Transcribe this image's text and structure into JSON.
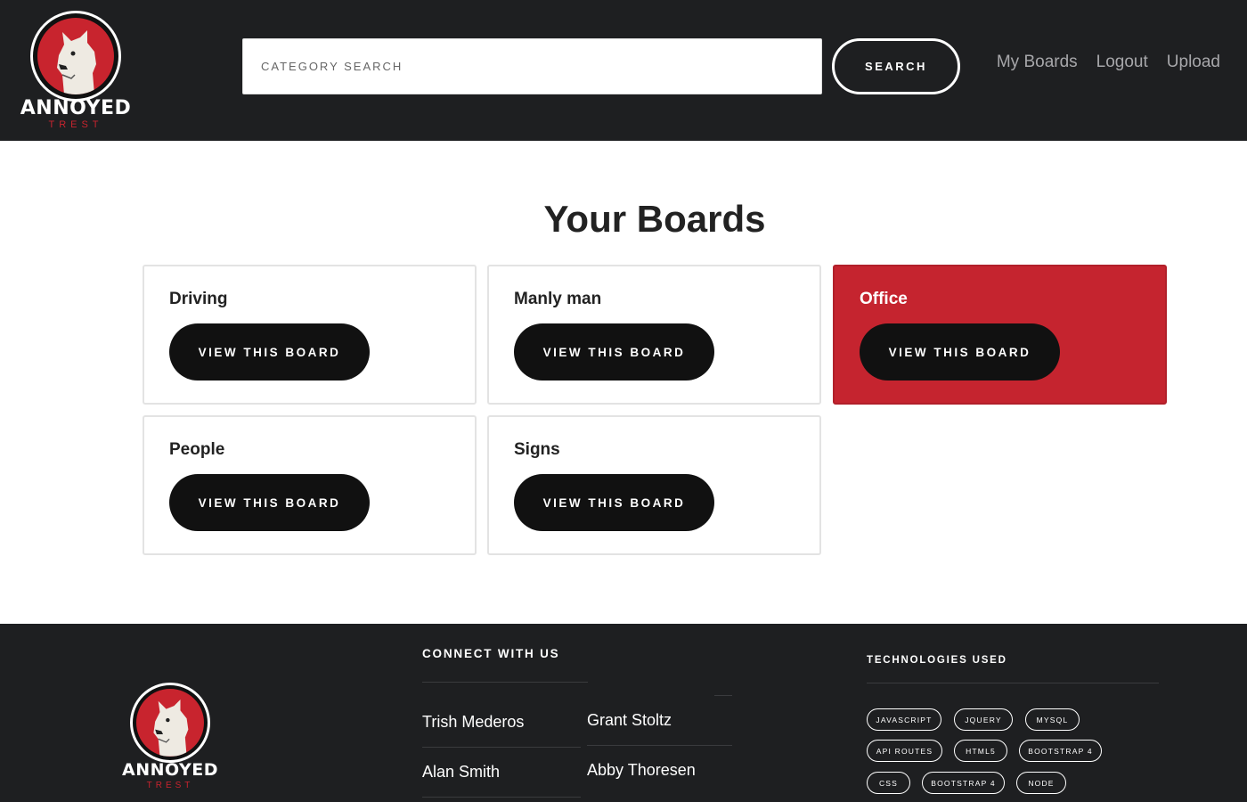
{
  "header": {
    "logo": {
      "word": "ANNOYED",
      "sub": "TREST"
    },
    "search": {
      "placeholder": "CATEGORY SEARCH",
      "button_label": "SEARCH"
    },
    "nav": [
      {
        "label": "My Boards"
      },
      {
        "label": "Logout"
      },
      {
        "label": "Upload"
      }
    ]
  },
  "main": {
    "title": "Your Boards",
    "boards": [
      {
        "name": "Driving",
        "button_label": "VIEW THIS BOARD",
        "active": false
      },
      {
        "name": "Manly man",
        "button_label": "VIEW THIS BOARD",
        "active": false
      },
      {
        "name": "Office",
        "button_label": "VIEW THIS BOARD",
        "active": true
      },
      {
        "name": "People",
        "button_label": "VIEW THIS BOARD",
        "active": false
      },
      {
        "name": "Signs",
        "button_label": "VIEW THIS BOARD",
        "active": false
      }
    ]
  },
  "footer": {
    "logo": {
      "word": "ANNOYED",
      "sub": "TREST"
    },
    "connect": {
      "heading": "CONNECT WITH US",
      "people": [
        "Trish Mederos",
        "Grant Stoltz",
        "Alan Smith",
        "Abby Thoresen"
      ]
    },
    "technologies": {
      "heading": "TECHNOLOGIES USED",
      "items": [
        "JAVASCRIPT",
        "JQUERY",
        "MYSQL",
        "API ROUTES",
        "HTML5",
        "BOOTSTRAP 4",
        "CSS",
        "BOOTSTRAP 4",
        "NODE"
      ]
    }
  },
  "colors": {
    "brand_red": "#c5242f",
    "header_bg": "#1e1f21",
    "button_bg": "#111111"
  }
}
